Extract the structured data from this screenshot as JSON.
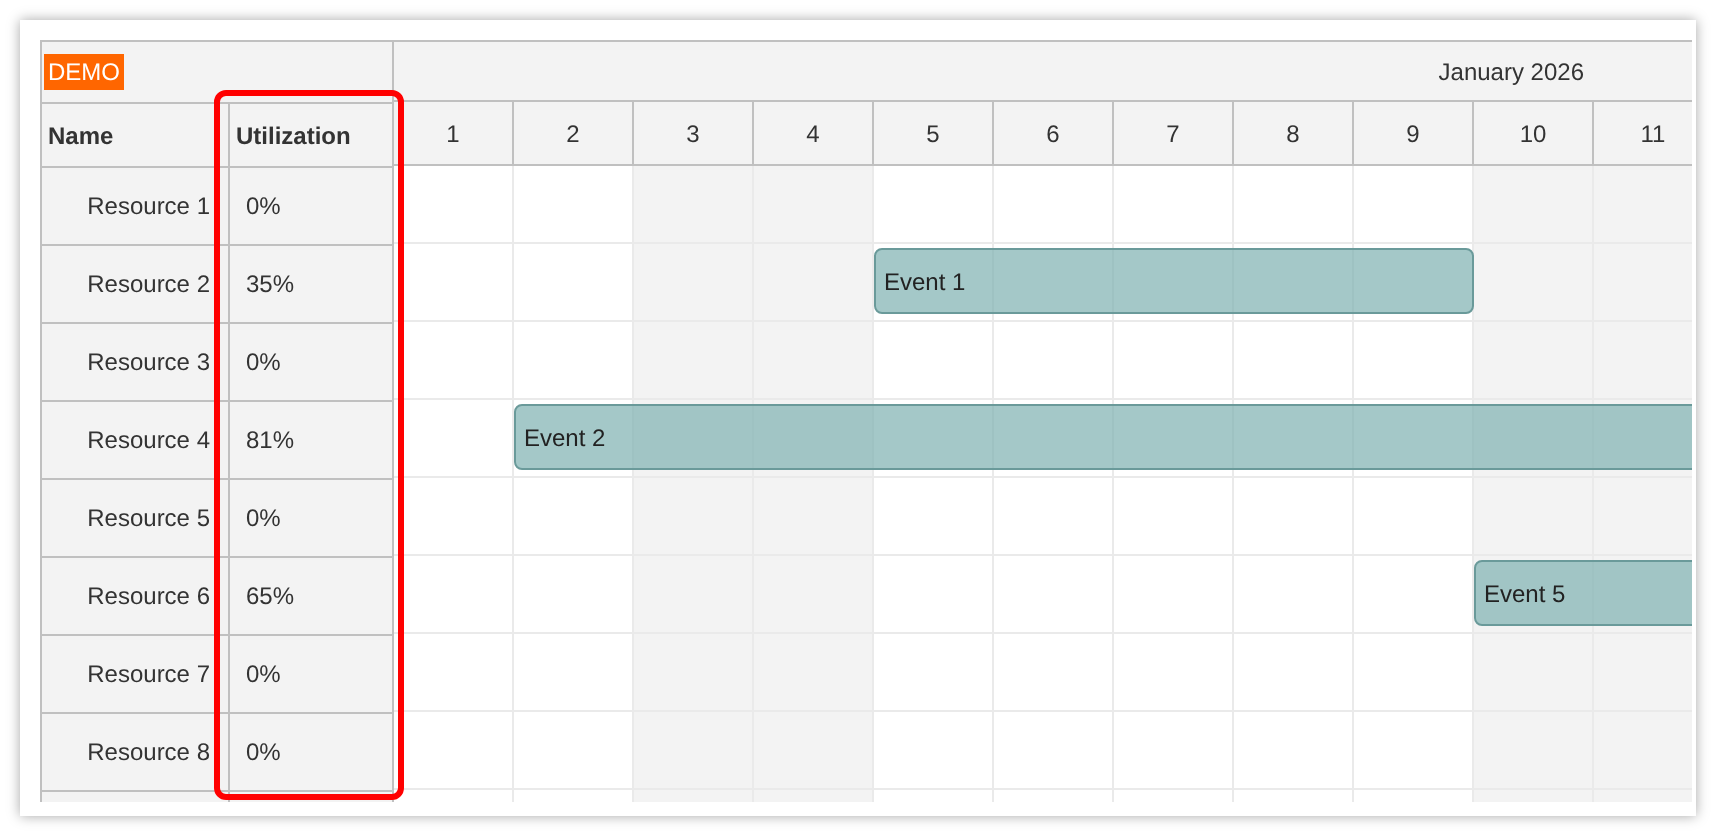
{
  "badge": "DEMO",
  "month": "January 2026",
  "columns": [
    "Name",
    "Utilization"
  ],
  "days": [
    {
      "label": "1",
      "weekend": false
    },
    {
      "label": "2",
      "weekend": false
    },
    {
      "label": "3",
      "weekend": true
    },
    {
      "label": "4",
      "weekend": true
    },
    {
      "label": "5",
      "weekend": false
    },
    {
      "label": "6",
      "weekend": false
    },
    {
      "label": "7",
      "weekend": false
    },
    {
      "label": "8",
      "weekend": false
    },
    {
      "label": "9",
      "weekend": false
    },
    {
      "label": "10",
      "weekend": true
    },
    {
      "label": "11",
      "weekend": true
    }
  ],
  "resources": [
    {
      "name": "Resource 1",
      "utilization": "0%"
    },
    {
      "name": "Resource 2",
      "utilization": "35%",
      "event": "Event 1"
    },
    {
      "name": "Resource 3",
      "utilization": "0%"
    },
    {
      "name": "Resource 4",
      "utilization": "81%",
      "event": "Event 2"
    },
    {
      "name": "Resource 5",
      "utilization": "0%"
    },
    {
      "name": "Resource 6",
      "utilization": "65%",
      "event": "Event 5"
    },
    {
      "name": "Resource 7",
      "utilization": "0%"
    },
    {
      "name": "Resource 8",
      "utilization": "0%"
    }
  ]
}
